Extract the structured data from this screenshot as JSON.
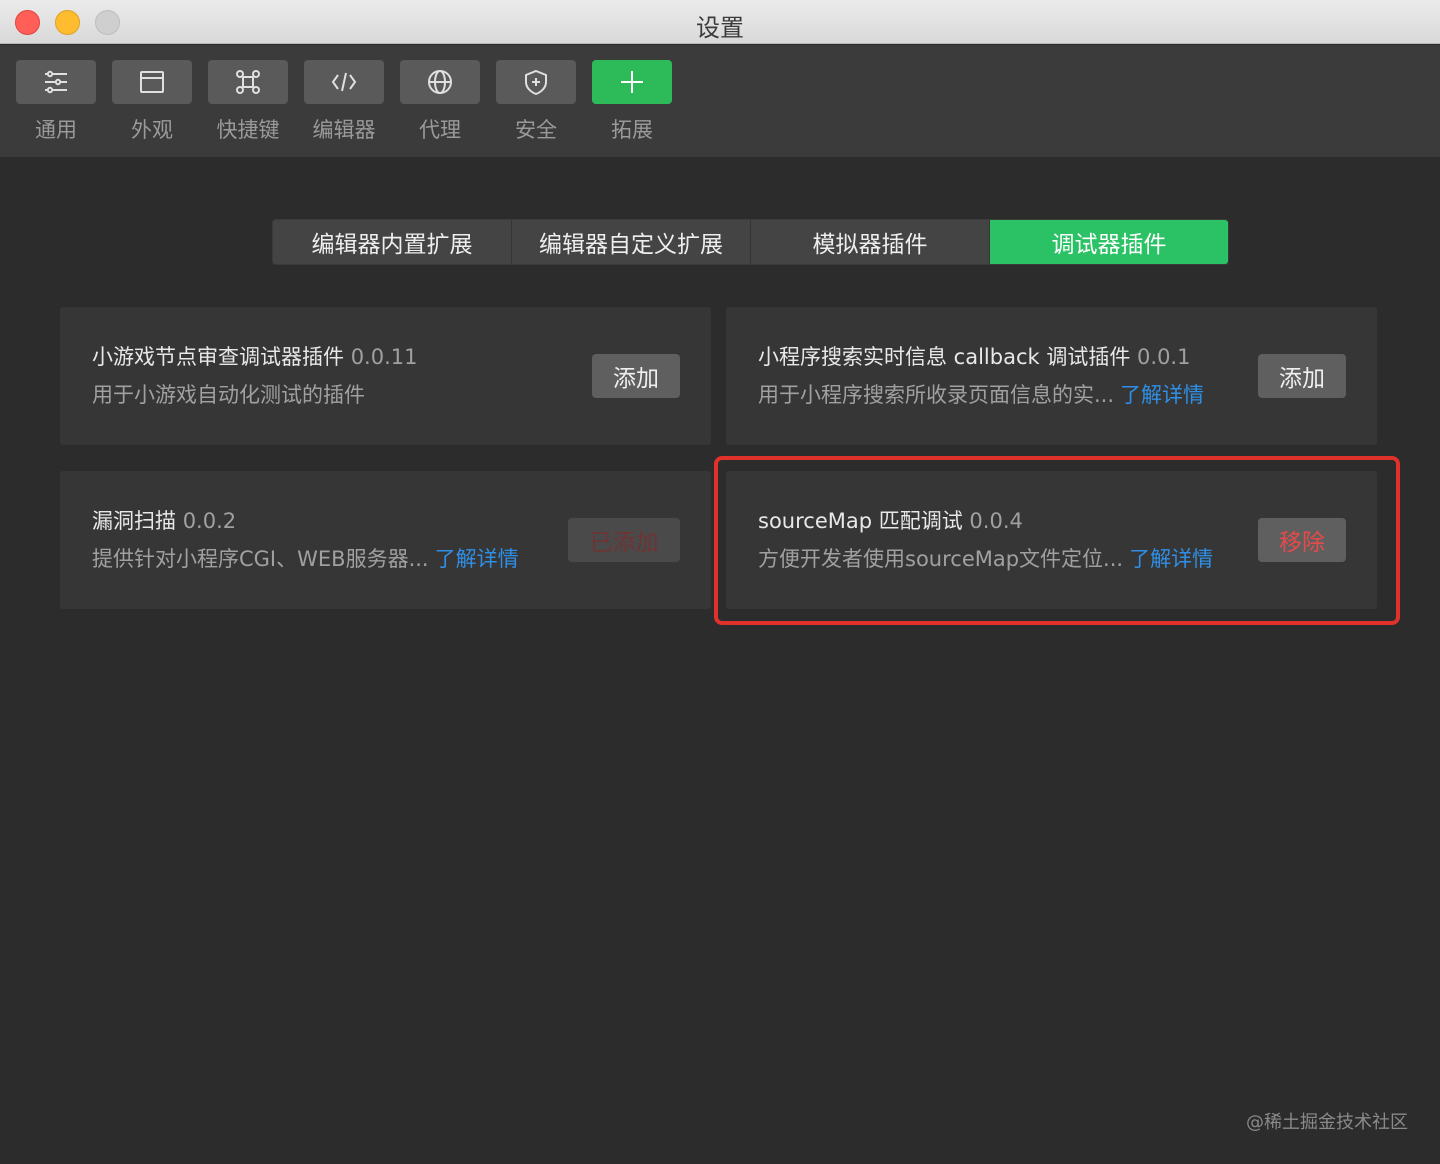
{
  "window": {
    "title": "设置"
  },
  "toolbar": {
    "items": [
      {
        "label": "通用",
        "icon": "sliders-icon"
      },
      {
        "label": "外观",
        "icon": "window-icon"
      },
      {
        "label": "快捷键",
        "icon": "command-icon"
      },
      {
        "label": "编辑器",
        "icon": "code-icon"
      },
      {
        "label": "代理",
        "icon": "globe-icon"
      },
      {
        "label": "安全",
        "icon": "shield-icon"
      },
      {
        "label": "拓展",
        "icon": "plus-icon",
        "active": true
      }
    ]
  },
  "tabs": [
    {
      "label": "编辑器内置扩展"
    },
    {
      "label": "编辑器自定义扩展"
    },
    {
      "label": "模拟器插件"
    },
    {
      "label": "调试器插件",
      "active": true
    }
  ],
  "plugins": [
    {
      "name": "小游戏节点审查调试器插件",
      "version": "0.0.11",
      "description": "用于小游戏自动化测试的插件",
      "more": "",
      "button": "添加"
    },
    {
      "name": "小程序搜索实时信息 callback 调试插件",
      "version": "0.0.1",
      "description": "用于小程序搜索所收录页面信息的实...",
      "more": "了解详情",
      "button": "添加"
    },
    {
      "name": "漏洞扫描",
      "version": "0.0.2",
      "description": "提供针对小程序CGI、WEB服务器...",
      "more": "了解详情",
      "button": "已添加"
    },
    {
      "name": "sourceMap 匹配调试",
      "version": "0.0.4",
      "description": "方便开发者使用sourceMap文件定位...",
      "more": "了解详情",
      "button": "移除"
    }
  ],
  "colors": {
    "accent": "#2ac264",
    "link": "#2f8fe6",
    "danger": "#e64a4a",
    "highlight": "#e0312b"
  },
  "watermark": "@稀土掘金技术社区"
}
